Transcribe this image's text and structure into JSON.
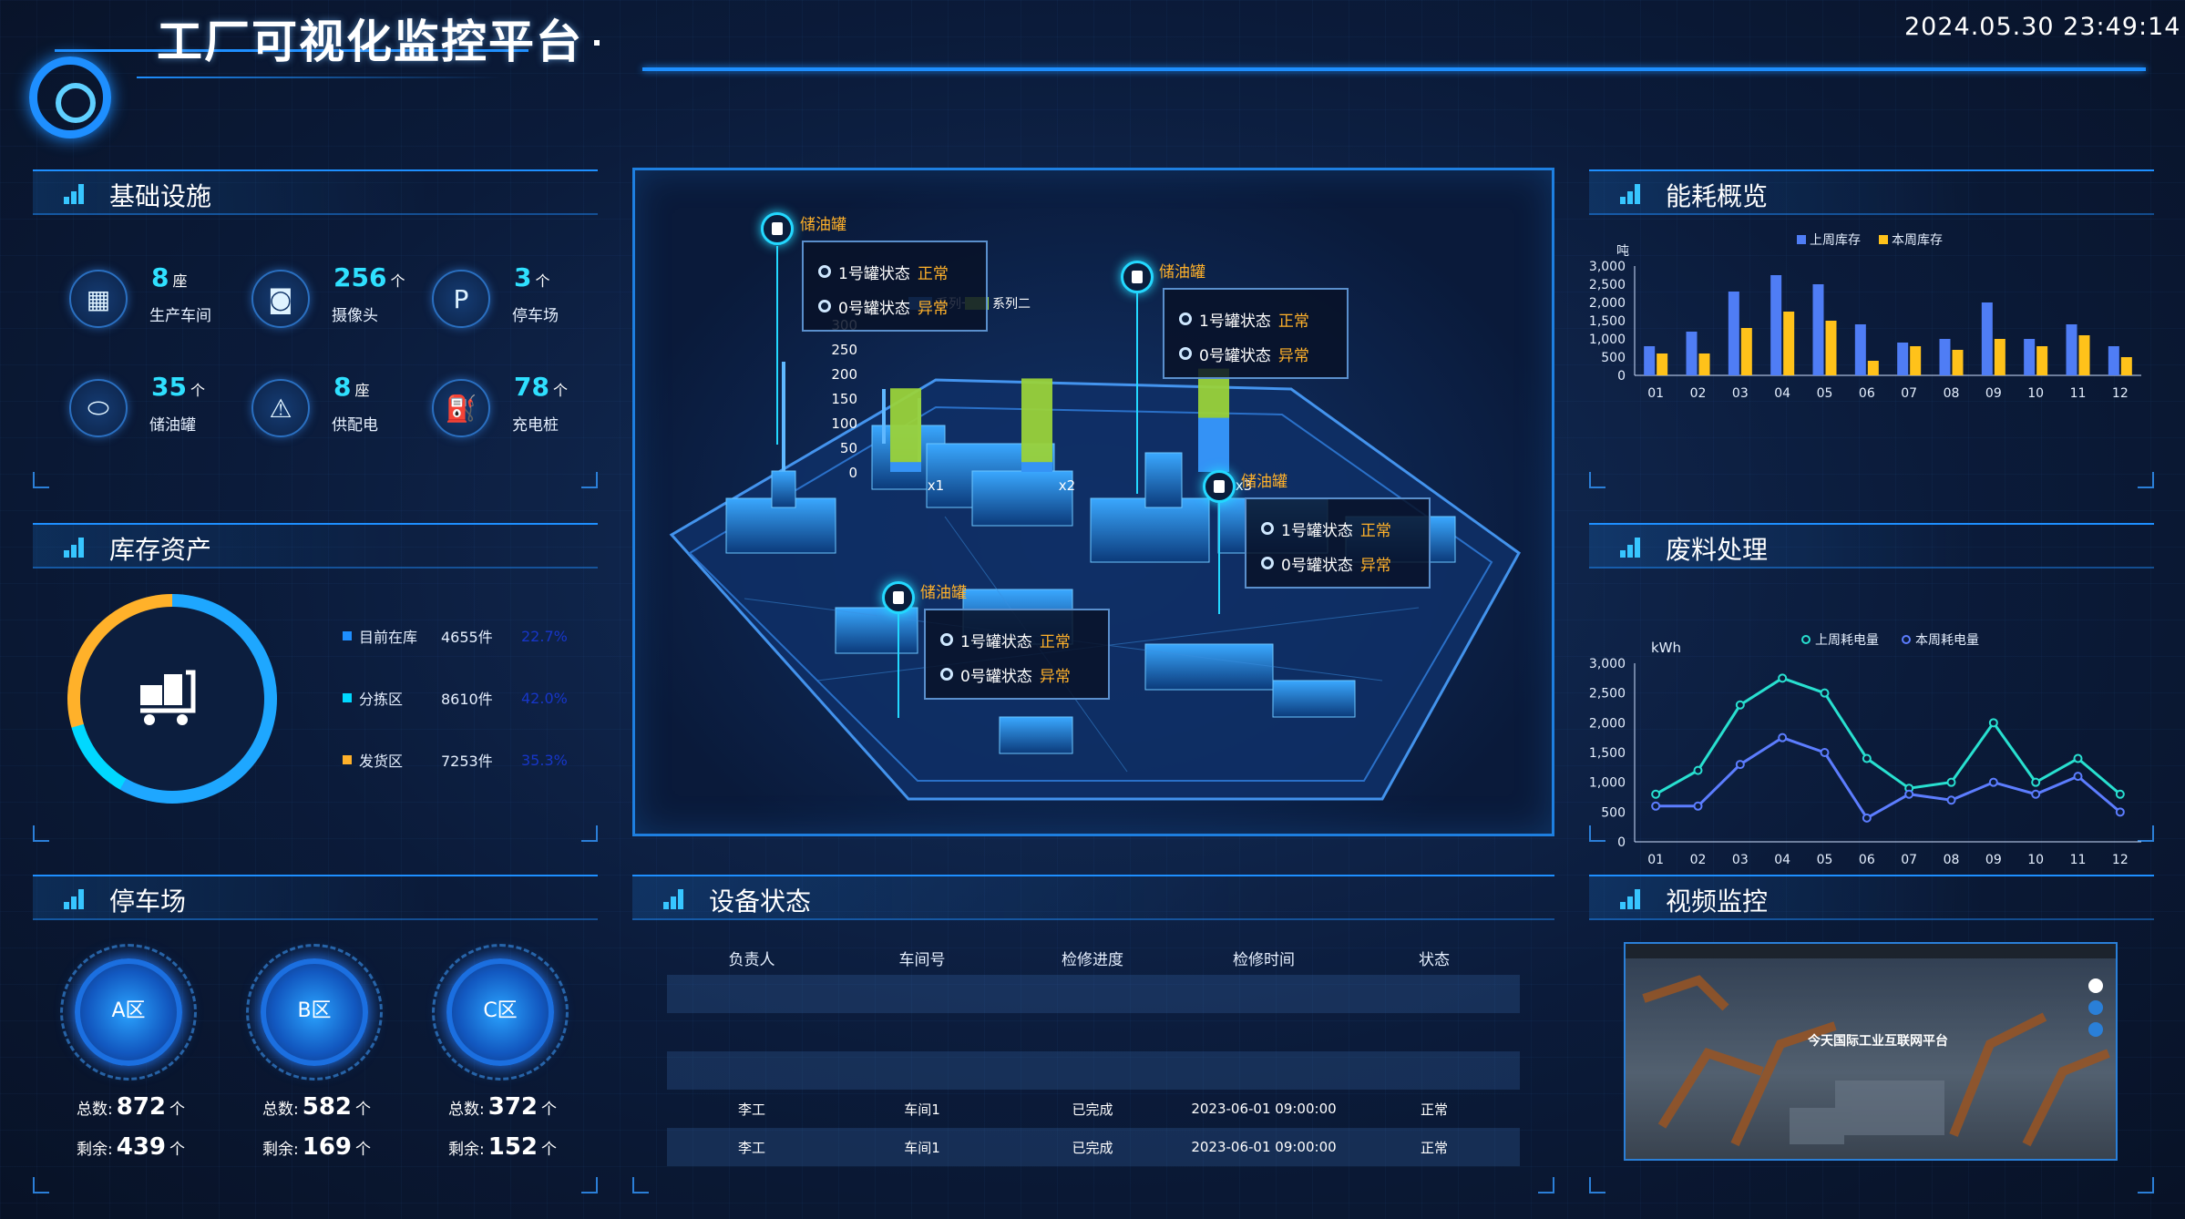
{
  "header": {
    "title": "工厂可视化监控平台",
    "datetime": "2024.05.30 23:49:14"
  },
  "infrastructure": {
    "title": "基础设施",
    "items": [
      {
        "value": "8",
        "unit": "座",
        "label": "生产车间",
        "icon": "building-icon"
      },
      {
        "value": "256",
        "unit": "个",
        "label": "摄像头",
        "icon": "camera-icon"
      },
      {
        "value": "3",
        "unit": "个",
        "label": "停车场",
        "icon": "parking-icon"
      },
      {
        "value": "35",
        "unit": "个",
        "label": "储油罐",
        "icon": "tank-icon"
      },
      {
        "value": "8",
        "unit": "座",
        "label": "供配电",
        "icon": "power-icon"
      },
      {
        "value": "78",
        "unit": "个",
        "label": "充电桩",
        "icon": "charger-icon"
      }
    ]
  },
  "inventory": {
    "title": "库存资产",
    "rows": [
      {
        "name": "目前在库",
        "value": "4655件",
        "pct": "22.7%",
        "color": "#1e8fff"
      },
      {
        "name": "分拣区",
        "value": "8610件",
        "pct": "42.0%",
        "color": "#00d8ff"
      },
      {
        "name": "发货区",
        "value": "7253件",
        "pct": "35.3%",
        "color": "#ffb12a"
      }
    ]
  },
  "parking": {
    "title": "停车场",
    "total_label": "总数:",
    "remain_label": "剩余:",
    "unit": "个",
    "areas": [
      {
        "name": "A区",
        "total": "872",
        "remain": "439"
      },
      {
        "name": "B区",
        "total": "582",
        "remain": "169"
      },
      {
        "name": "C区",
        "total": "372",
        "remain": "152"
      }
    ]
  },
  "center": {
    "tanks": [
      {
        "name": "储油罐",
        "s1": "1号罐状态",
        "s1v": "正常",
        "s0": "0号罐状态",
        "s0v": "异常"
      },
      {
        "name": "储油罐",
        "s1": "1号罐状态",
        "s1v": "正常",
        "s0": "0号罐状态",
        "s0v": "异常"
      },
      {
        "name": "储油罐",
        "s1": "1号罐状态",
        "s1v": "正常",
        "s0": "0号罐状态",
        "s0v": "异常"
      },
      {
        "name": "储油罐",
        "s1": "1号罐状态",
        "s1v": "正常",
        "s0": "0号罐状态",
        "s0v": "异常"
      }
    ],
    "legend": [
      "系列一",
      "系列二"
    ]
  },
  "equipment": {
    "title": "设备状态",
    "headers": [
      "负责人",
      "车间号",
      "检修进度",
      "检修时间",
      "状态"
    ],
    "rows": [
      [
        "",
        "",
        "",
        "",
        ""
      ],
      [
        "",
        "",
        "",
        "",
        ""
      ],
      [
        "",
        "",
        "",
        "",
        ""
      ],
      [
        "李工",
        "车间1",
        "已完成",
        "2023-06-01 09:00:00",
        "正常"
      ],
      [
        "李工",
        "车间1",
        "已完成",
        "2023-06-01 09:00:00",
        "正常"
      ]
    ]
  },
  "energy": {
    "title": "能耗概览"
  },
  "waste": {
    "title": "废料处理"
  },
  "video": {
    "title": "视频监控",
    "banner": "今天国际工业互联网平台"
  },
  "chart_data": [
    {
      "type": "bar",
      "title": "",
      "ylabel": "吨",
      "ylim": [
        0,
        3000
      ],
      "yticks": [
        "3,000",
        "2,500",
        "2,000",
        "1,500",
        "1,000",
        "500",
        "0"
      ],
      "categories": [
        "01",
        "02",
        "03",
        "04",
        "05",
        "06",
        "07",
        "08",
        "09",
        "10",
        "11",
        "12"
      ],
      "series": [
        {
          "name": "上周库存",
          "color": "#4f7df5",
          "values": [
            800,
            1200,
            2300,
            2750,
            2500,
            1400,
            900,
            1000,
            2000,
            1000,
            1400,
            800
          ]
        },
        {
          "name": "本周库存",
          "color": "#ffc21a",
          "values": [
            600,
            600,
            1300,
            1750,
            1500,
            400,
            800,
            700,
            1000,
            800,
            1100,
            500
          ]
        }
      ]
    },
    {
      "type": "line",
      "title": "",
      "ylabel": "kWh",
      "ylim": [
        0,
        3000
      ],
      "yticks": [
        "3,000",
        "2,500",
        "2,000",
        "1,500",
        "1,000",
        "500",
        "0"
      ],
      "categories": [
        "01",
        "02",
        "03",
        "04",
        "05",
        "06",
        "07",
        "08",
        "09",
        "10",
        "11",
        "12"
      ],
      "series": [
        {
          "name": "上周耗电量",
          "color": "#28e0d0",
          "values": [
            800,
            1200,
            2300,
            2750,
            2500,
            1400,
            900,
            1000,
            2000,
            1000,
            1400,
            800
          ]
        },
        {
          "name": "本周耗电量",
          "color": "#5c7dff",
          "values": [
            600,
            600,
            1300,
            1750,
            1500,
            400,
            800,
            700,
            1000,
            800,
            1100,
            500
          ]
        }
      ]
    },
    {
      "type": "bar",
      "title": "",
      "ylim": [
        0,
        300
      ],
      "yticks": [
        "300",
        "250",
        "200",
        "150",
        "100",
        "50",
        "0"
      ],
      "categories": [
        "x1",
        "x2",
        "x3"
      ],
      "series": [
        {
          "name": "系列一",
          "color": "#2f8fff",
          "values": [
            20,
            20,
            110
          ]
        },
        {
          "name": "系列二",
          "color": "#9ad23a",
          "values": [
            170,
            190,
            210
          ]
        }
      ]
    }
  ]
}
